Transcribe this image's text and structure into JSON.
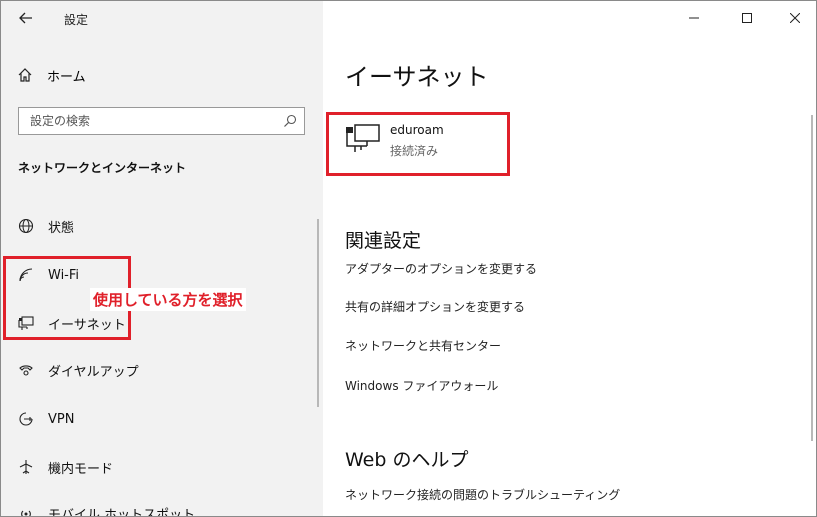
{
  "window": {
    "title": "設定"
  },
  "sidebar": {
    "home_label": "ホーム",
    "search_placeholder": "設定の検索",
    "section_title": "ネットワークとインターネット",
    "items": [
      {
        "label": "状態",
        "icon": "globe-icon"
      },
      {
        "label": "Wi-Fi",
        "icon": "wifi-icon"
      },
      {
        "label": "イーサネット",
        "icon": "ethernet-icon"
      },
      {
        "label": "ダイヤルアップ",
        "icon": "dialup-icon"
      },
      {
        "label": "VPN",
        "icon": "vpn-icon"
      },
      {
        "label": "機内モード",
        "icon": "airplane-icon"
      },
      {
        "label": "モバイル ホットスポット",
        "icon": "hotspot-icon"
      }
    ]
  },
  "annotation": {
    "text": "使用している方を選択",
    "color": "#e0202a"
  },
  "main": {
    "title": "イーサネット",
    "network": {
      "name": "eduroam",
      "status": "接続済み"
    },
    "related_title": "関連設定",
    "related_links": [
      "アダプターのオプションを変更する",
      "共有の詳細オプションを変更する",
      "ネットワークと共有センター",
      "Windows ファイアウォール"
    ],
    "help_title": "Web のヘルプ",
    "help_links": [
      "ネットワーク接続の問題のトラブルシューティング"
    ]
  }
}
